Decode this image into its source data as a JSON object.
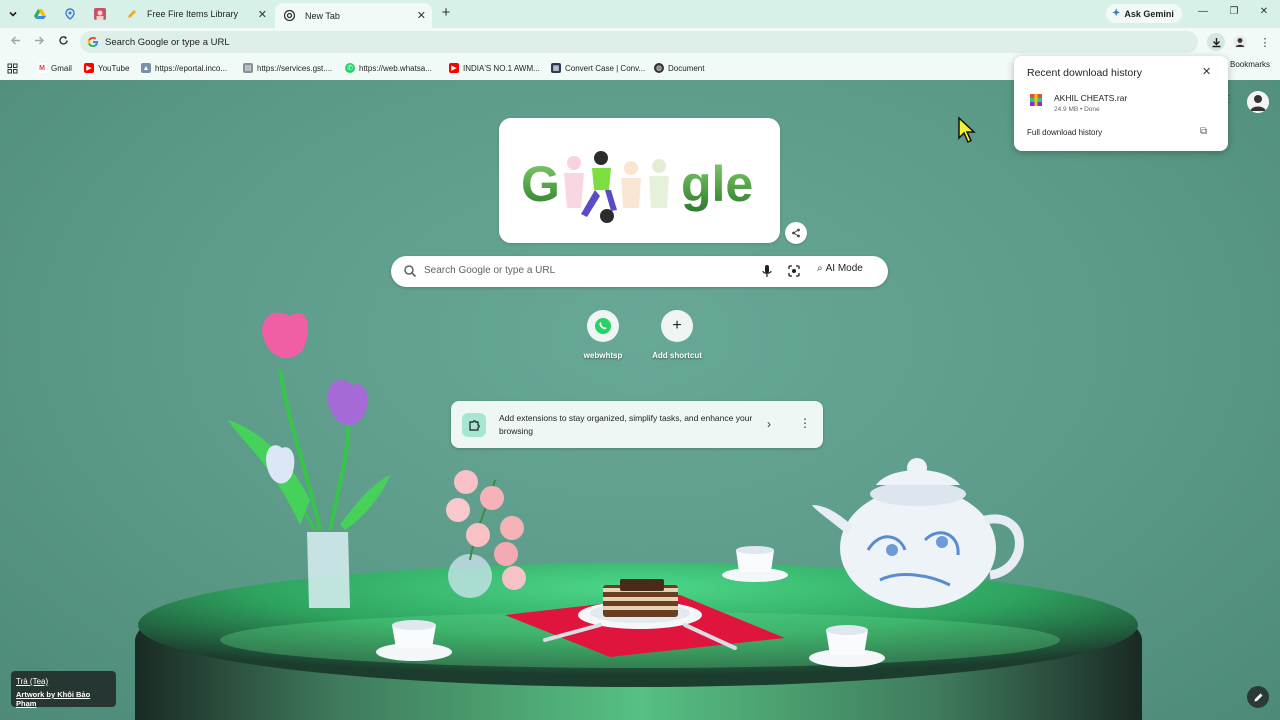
{
  "tabs": [
    {
      "label": "Free Fire Items Library",
      "active": false
    },
    {
      "label": "New Tab",
      "active": true
    }
  ],
  "tabstrip": {
    "gemini_label": "Ask Gemini"
  },
  "toolbar": {
    "omnibox_placeholder": "Search Google or type a URL"
  },
  "bookmarks": [
    {
      "label": "Gmail",
      "icon": "gmail-icon"
    },
    {
      "label": "YouTube",
      "icon": "youtube-icon"
    },
    {
      "label": "https://eportal.inco...",
      "icon": "site-icon"
    },
    {
      "label": "https://services.gst....",
      "icon": "site-icon"
    },
    {
      "label": "https://web.whatsa...",
      "icon": "whatsapp-icon"
    },
    {
      "label": "INDIA'S NO.1 AWM...",
      "icon": "youtube-icon"
    },
    {
      "label": "Convert Case | Conv...",
      "icon": "site-icon"
    },
    {
      "label": "Document",
      "icon": "globe-icon"
    }
  ],
  "bookmarks_right": "l Bookmarks",
  "search": {
    "placeholder": "Search Google or type a URL",
    "ai_mode": "AI Mode"
  },
  "shortcuts": [
    {
      "label": "webwhtsp"
    },
    {
      "label": "Add shortcut"
    }
  ],
  "extension_card": {
    "text": "Add extensions to stay organized, simplify tasks, and enhance your browsing"
  },
  "download_popup": {
    "title": "Recent download history",
    "file_name": "AKHIL CHEATS.rar",
    "file_meta": "24.9 MB • Done",
    "full_history": "Full download history"
  },
  "credit": {
    "title": "Trà (Tea)",
    "artist": "Artwork by Khôi Bảo Phạm"
  },
  "colors": {
    "accent": "#1a73e8",
    "tabstrip": "#d7f0e8",
    "toolbar": "#f1faf6",
    "background": "#5f9e8e"
  }
}
